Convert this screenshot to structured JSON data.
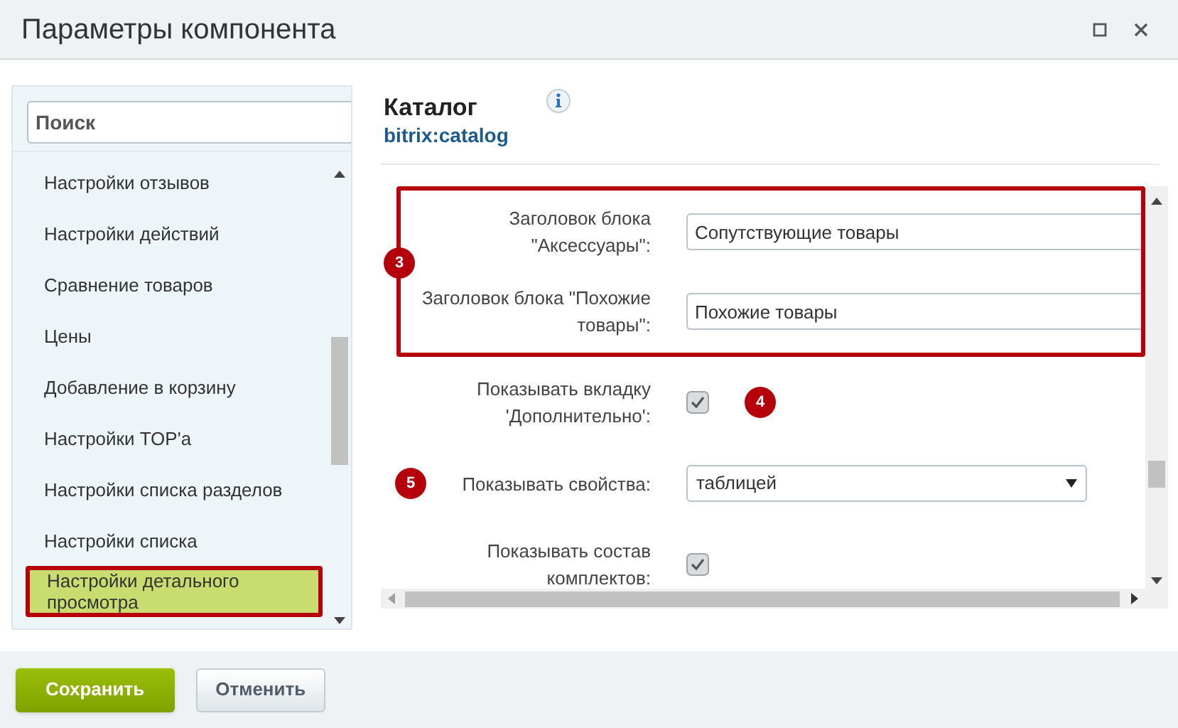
{
  "window": {
    "title": "Параметры компонента"
  },
  "sidebar": {
    "search": {
      "placeholder": "Поиск"
    },
    "items": [
      {
        "label": "Настройки отзывов",
        "selected": false
      },
      {
        "label": "Настройки действий",
        "selected": false
      },
      {
        "label": "Сравнение товаров",
        "selected": false
      },
      {
        "label": "Цены",
        "selected": false
      },
      {
        "label": "Добавление в корзину",
        "selected": false
      },
      {
        "label": "Настройки TOP'а",
        "selected": false
      },
      {
        "label": "Настройки списка разделов",
        "selected": false
      },
      {
        "label": "Настройки списка",
        "selected": false
      },
      {
        "label": "Настройки детального просмотра",
        "selected": true
      }
    ]
  },
  "component": {
    "title": "Каталог",
    "code": "bitrix:catalog"
  },
  "form": {
    "group_badge": "3",
    "rows": [
      {
        "kind": "text",
        "label": "Заголовок блока \"Аксессуары\":",
        "value": "Сопутствующие товары",
        "framed": true
      },
      {
        "kind": "text",
        "label": "Заголовок блока \"Похожие товары\":",
        "value": "Похожие товары",
        "framed": true
      },
      {
        "kind": "checkbox",
        "label": "Показывать вкладку 'Дополнительно':",
        "checked": true,
        "badge": "4"
      },
      {
        "kind": "select",
        "label": "Показывать свойства:",
        "value": "таблицей",
        "badge": "5"
      },
      {
        "kind": "checkbox",
        "label": "Показывать состав комплектов:",
        "checked": true
      }
    ]
  },
  "buttons": [
    {
      "label": "Сохранить",
      "kind": "primary"
    },
    {
      "label": "Отменить",
      "kind": "secondary"
    }
  ]
}
